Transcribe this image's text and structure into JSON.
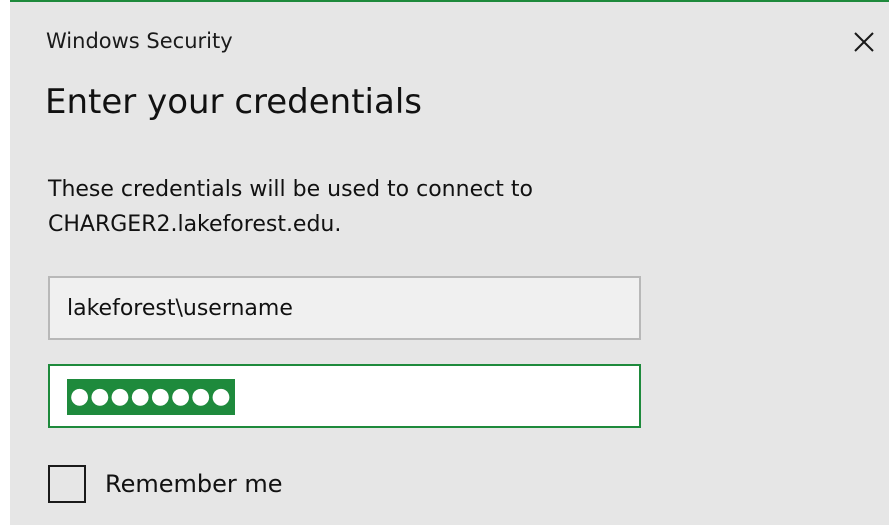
{
  "window": {
    "title": "Windows Security",
    "close_icon": "close-icon",
    "accent_color": "#1e8a3c"
  },
  "dialog": {
    "heading": "Enter your credentials",
    "description_line1": "These credentials will be used to connect to",
    "description_line2": "CHARGER2.lakeforest.edu."
  },
  "username": {
    "value": "lakeforest\\username"
  },
  "password": {
    "masked_value": "●●●●●●●●"
  },
  "remember": {
    "label": "Remember me",
    "checked": false
  }
}
